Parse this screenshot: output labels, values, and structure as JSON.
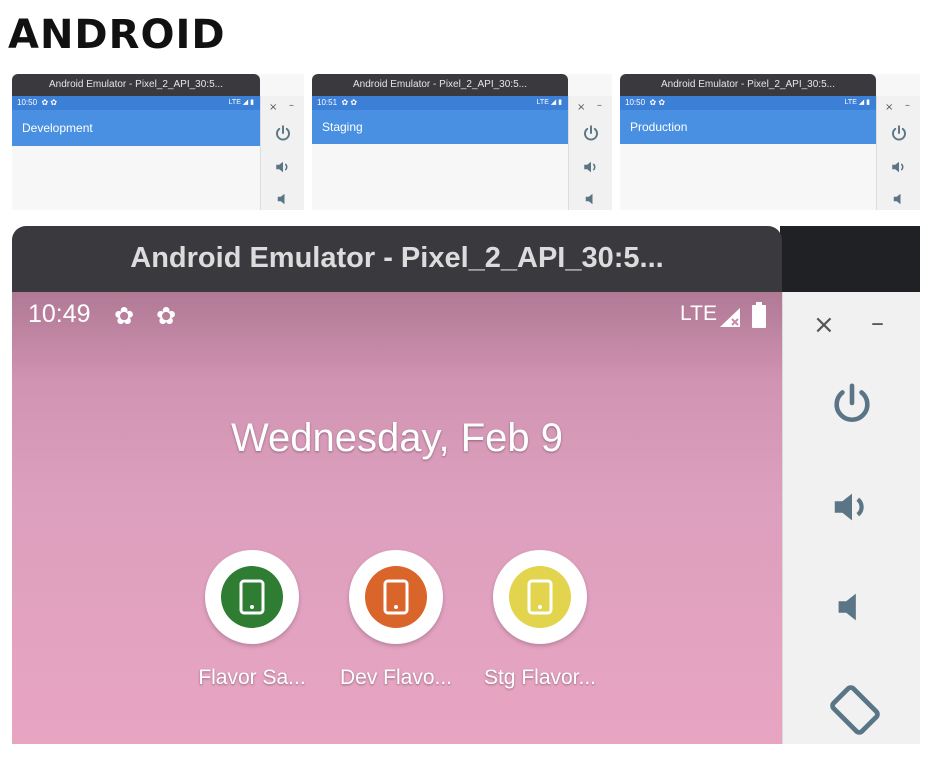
{
  "heading": "ANDROID",
  "mini_emulators": [
    {
      "window_title": "Android Emulator - Pixel_2_API_30:5...",
      "time": "10:50",
      "status_right": "LTE ◢ ▮",
      "app_bar_title": "Development"
    },
    {
      "window_title": "Android Emulator - Pixel_2_API_30:5...",
      "time": "10:51",
      "status_right": "LTE ◢ ▮",
      "app_bar_title": "Staging"
    },
    {
      "window_title": "Android Emulator - Pixel_2_API_30:5...",
      "time": "10:50",
      "status_right": "LTE ◢ ▮",
      "app_bar_title": "Production"
    }
  ],
  "main_emulator": {
    "window_title": "Android Emulator - Pixel_2_API_30:5...",
    "time": "10:49",
    "network": "LTE",
    "date": "Wednesday, Feb 9",
    "apps": [
      {
        "label": "Flavor Sa...",
        "color": "#2e7d32"
      },
      {
        "label": "Dev Flavo...",
        "color": "#d9652b"
      },
      {
        "label": "Stg Flavor...",
        "color": "#e3d44e"
      }
    ]
  },
  "side_controls": {
    "close": "×",
    "minimize": "–",
    "icons": [
      "power-icon",
      "volume-up-icon",
      "volume-down-icon",
      "rotate-icon"
    ]
  },
  "colors": {
    "status_bar_blue": "#3c7fd6",
    "app_bar_blue": "#4a90e2",
    "title_bar": "#3a3a3e",
    "icon_slate": "#5a7585"
  }
}
